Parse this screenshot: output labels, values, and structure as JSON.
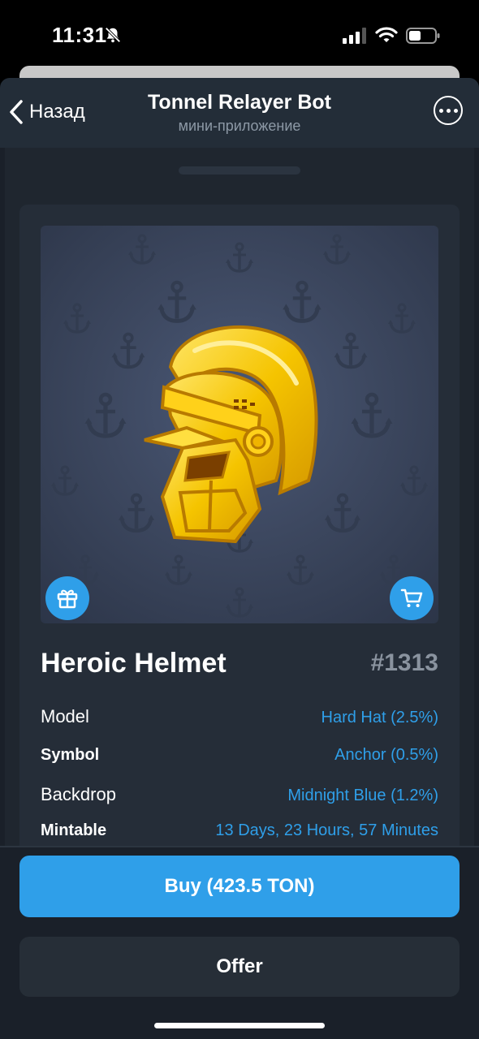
{
  "status_bar": {
    "time": "11:31",
    "icons": [
      "bell-slash-icon",
      "cellular-signal-icon",
      "wifi-icon",
      "battery-icon"
    ]
  },
  "header": {
    "back_label": "Назад",
    "title": "Tonnel Relayer Bot",
    "subtitle": "мини-приложение",
    "back_icon": "chevron-left-icon",
    "more_icon": "ellipsis-circle-icon"
  },
  "gift": {
    "name": "Heroic Helmet",
    "number": "#1313",
    "image_icon": "helmet-icon",
    "pattern_icon": "anchor-icon",
    "gift_button_icon": "gift-icon",
    "cart_button_icon": "cart-icon",
    "attributes": [
      {
        "label": "Model",
        "value": "Hard Hat (2.5%)"
      },
      {
        "label": "Symbol",
        "value": "Anchor (0.5%)"
      },
      {
        "label": "Backdrop",
        "value": "Midnight Blue (1.2%)"
      },
      {
        "label": "Mintable",
        "value": "13 Days, 23 Hours, 57 Minutes"
      }
    ]
  },
  "actions": {
    "buy_label": "Buy (423.5 TON)",
    "offer_label": "Offer"
  },
  "colors": {
    "accent": "#2f9fe9",
    "header_bg": "#232d38",
    "app_bg": "#1a2029",
    "card_bg": "#252d38",
    "backdrop": "#3d4860",
    "helmet_gold": "#f5c400"
  }
}
